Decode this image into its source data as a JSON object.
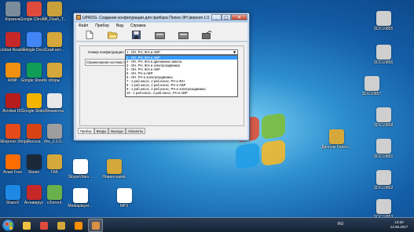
{
  "desktop_icons_left": [
    {
      "label": "Корзина",
      "color": "#7a8b9b",
      "icon": "recycle-bin-icon"
    },
    {
      "label": "Google Chrome",
      "color": "#de4b3c",
      "icon": "chrome-icon"
    },
    {
      "label": "SP_Flash_T...",
      "color": "#c9a13a",
      "icon": "folder-icon"
    },
    {
      "label": "Acrobat Reader DC",
      "color": "#c62828",
      "icon": "acrobat-icon"
    },
    {
      "label": "Google Docs",
      "color": "#4285f4",
      "icon": "docs-icon"
    },
    {
      "label": "Скай.нет...",
      "color": "#d4a83a",
      "icon": "folder-icon"
    },
    {
      "label": "AIMP",
      "color": "#f29111",
      "icon": "aimp-icon"
    },
    {
      "label": "Google Sheets",
      "color": "#0f9d58",
      "icon": "sheets-icon"
    },
    {
      "label": "оборы",
      "color": "#d4a83a",
      "icon": "folder-icon"
    },
    {
      "label": "Acrobat DC",
      "color": "#b71c1c",
      "icon": "acrobat-icon"
    },
    {
      "label": "Google Slides",
      "color": "#f4b400",
      "icon": "slides-icon"
    },
    {
      "label": "Элементы",
      "color": "#e8e8e8",
      "icon": "document-icon"
    },
    {
      "label": "AliExpress Shopper",
      "color": "#e64a19",
      "icon": "aliexpress-icon"
    },
    {
      "label": "Recuva",
      "color": "#d84315",
      "icon": "recuva-icon"
    },
    {
      "label": "dnc_2.0.0...",
      "color": "#9e9e9e",
      "icon": "archive-icon"
    },
    {
      "label": "Avast Free",
      "color": "#ff6d00",
      "icon": "avast-icon"
    },
    {
      "label": "Steam",
      "color": "#1b2838",
      "icon": "steam-icon"
    },
    {
      "label": "ТАБ",
      "color": "#d4a83a",
      "icon": "folder-icon"
    },
    {
      "label": "ShareX",
      "color": "#1e88e5",
      "icon": "sharex-icon"
    },
    {
      "label": "Антивирус",
      "color": "#c62828",
      "icon": "antivirus-icon"
    },
    {
      "label": "uTorrent",
      "color": "#6ab04c",
      "icon": "utorrent-icon"
    }
  ],
  "desktop_icons_mid": [
    {
      "label": "SkypeVideo...",
      "color": "#ffffff",
      "icon": "document-icon"
    },
    {
      "label": "Mediaplayer...",
      "color": "#ffffff",
      "icon": "video-file-icon"
    },
    {
      "label": "MP3",
      "color": "#ffffff",
      "icon": "audio-file-icon"
    },
    {
      "label": "Новая папка",
      "color": "#d4a83a",
      "icon": "folder-icon"
    }
  ],
  "desktop_icons_right": [
    {
      "label": "SDC10855",
      "color": "#cfcfcf",
      "icon": "photo-icon"
    },
    {
      "label": "SDC10856",
      "color": "#cfcfcf",
      "icon": "photo-icon"
    },
    {
      "label": "SDC10857",
      "color": "#cfcfcf",
      "icon": "photo-icon"
    },
    {
      "label": "SDC10858",
      "color": "#cfcfcf",
      "icon": "photo-icon"
    },
    {
      "label": "SDC10851",
      "color": "#cfcfcf",
      "icon": "photo-icon"
    },
    {
      "label": "SDC10852",
      "color": "#cfcfcf",
      "icon": "photo-icon"
    },
    {
      "label": "SDC10853",
      "color": "#cfcfcf",
      "icon": "photo-icon"
    },
    {
      "label": "Диплом Рабоч...",
      "color": "#d4a83a",
      "icon": "folder-icon"
    }
  ],
  "window": {
    "title": "UPROG. Создание конфигурации для прибора Полюс-9Н (версия 1.01)",
    "minimize": "_",
    "maximize": "□",
    "close": "✕",
    "menu": [
      "Файл",
      "Прибор",
      "Вид",
      "Справка"
    ],
    "toolbar_icons": [
      "new-document-icon",
      "open-folder-icon",
      "save-icon",
      "read-device-icon",
      "write-device-icon",
      "program-icon"
    ],
    "config_number_label": "Номер конфигурации:",
    "selected_config": "1 - ОН, РН, ЖН и АВР",
    "dropdown_arrow": "▼",
    "system_label": "Спринклерная система пожа...",
    "options": [
      "1 - ОН, РН, ЖН и АВР",
      "2 - ОН, РН, ЖН и дренажная завеса",
      "3 - ОН, РН, ЖН и электрозадвижка",
      "4 - ОН, РН, ЖН и АВР",
      "5 - ОН, РН и АВР",
      "6 - ОН, РН и электрозадвижка",
      "7 - 1 раб.насос, 2 раб.насос, РН и ЖН",
      "8 - 1 раб.насос, 2 раб.насос, РН и АВР",
      "9 - 1 раб.насос, 2 раб.насос, РН и электрозадвижка",
      "10 - 1 раб.насос, 2 раб.насос, РН и АВР"
    ],
    "tabs": [
      "Прибор",
      "Входы",
      "Выходы",
      "Абоненты"
    ],
    "active_tab": "Прибор"
  },
  "taskbar": {
    "apps": [
      {
        "icon": "explorer-icon",
        "color": "#f0c040"
      },
      {
        "icon": "chrome-icon",
        "color": "#de4b3c"
      },
      {
        "icon": "folder-icon",
        "color": "#d4a83a"
      },
      {
        "icon": "media-player-icon",
        "color": "#ff8f00"
      },
      {
        "icon": "uprog-icon",
        "color": "#d99044"
      }
    ],
    "language": "RU",
    "time": "13:20",
    "date": "14.06.2017"
  }
}
